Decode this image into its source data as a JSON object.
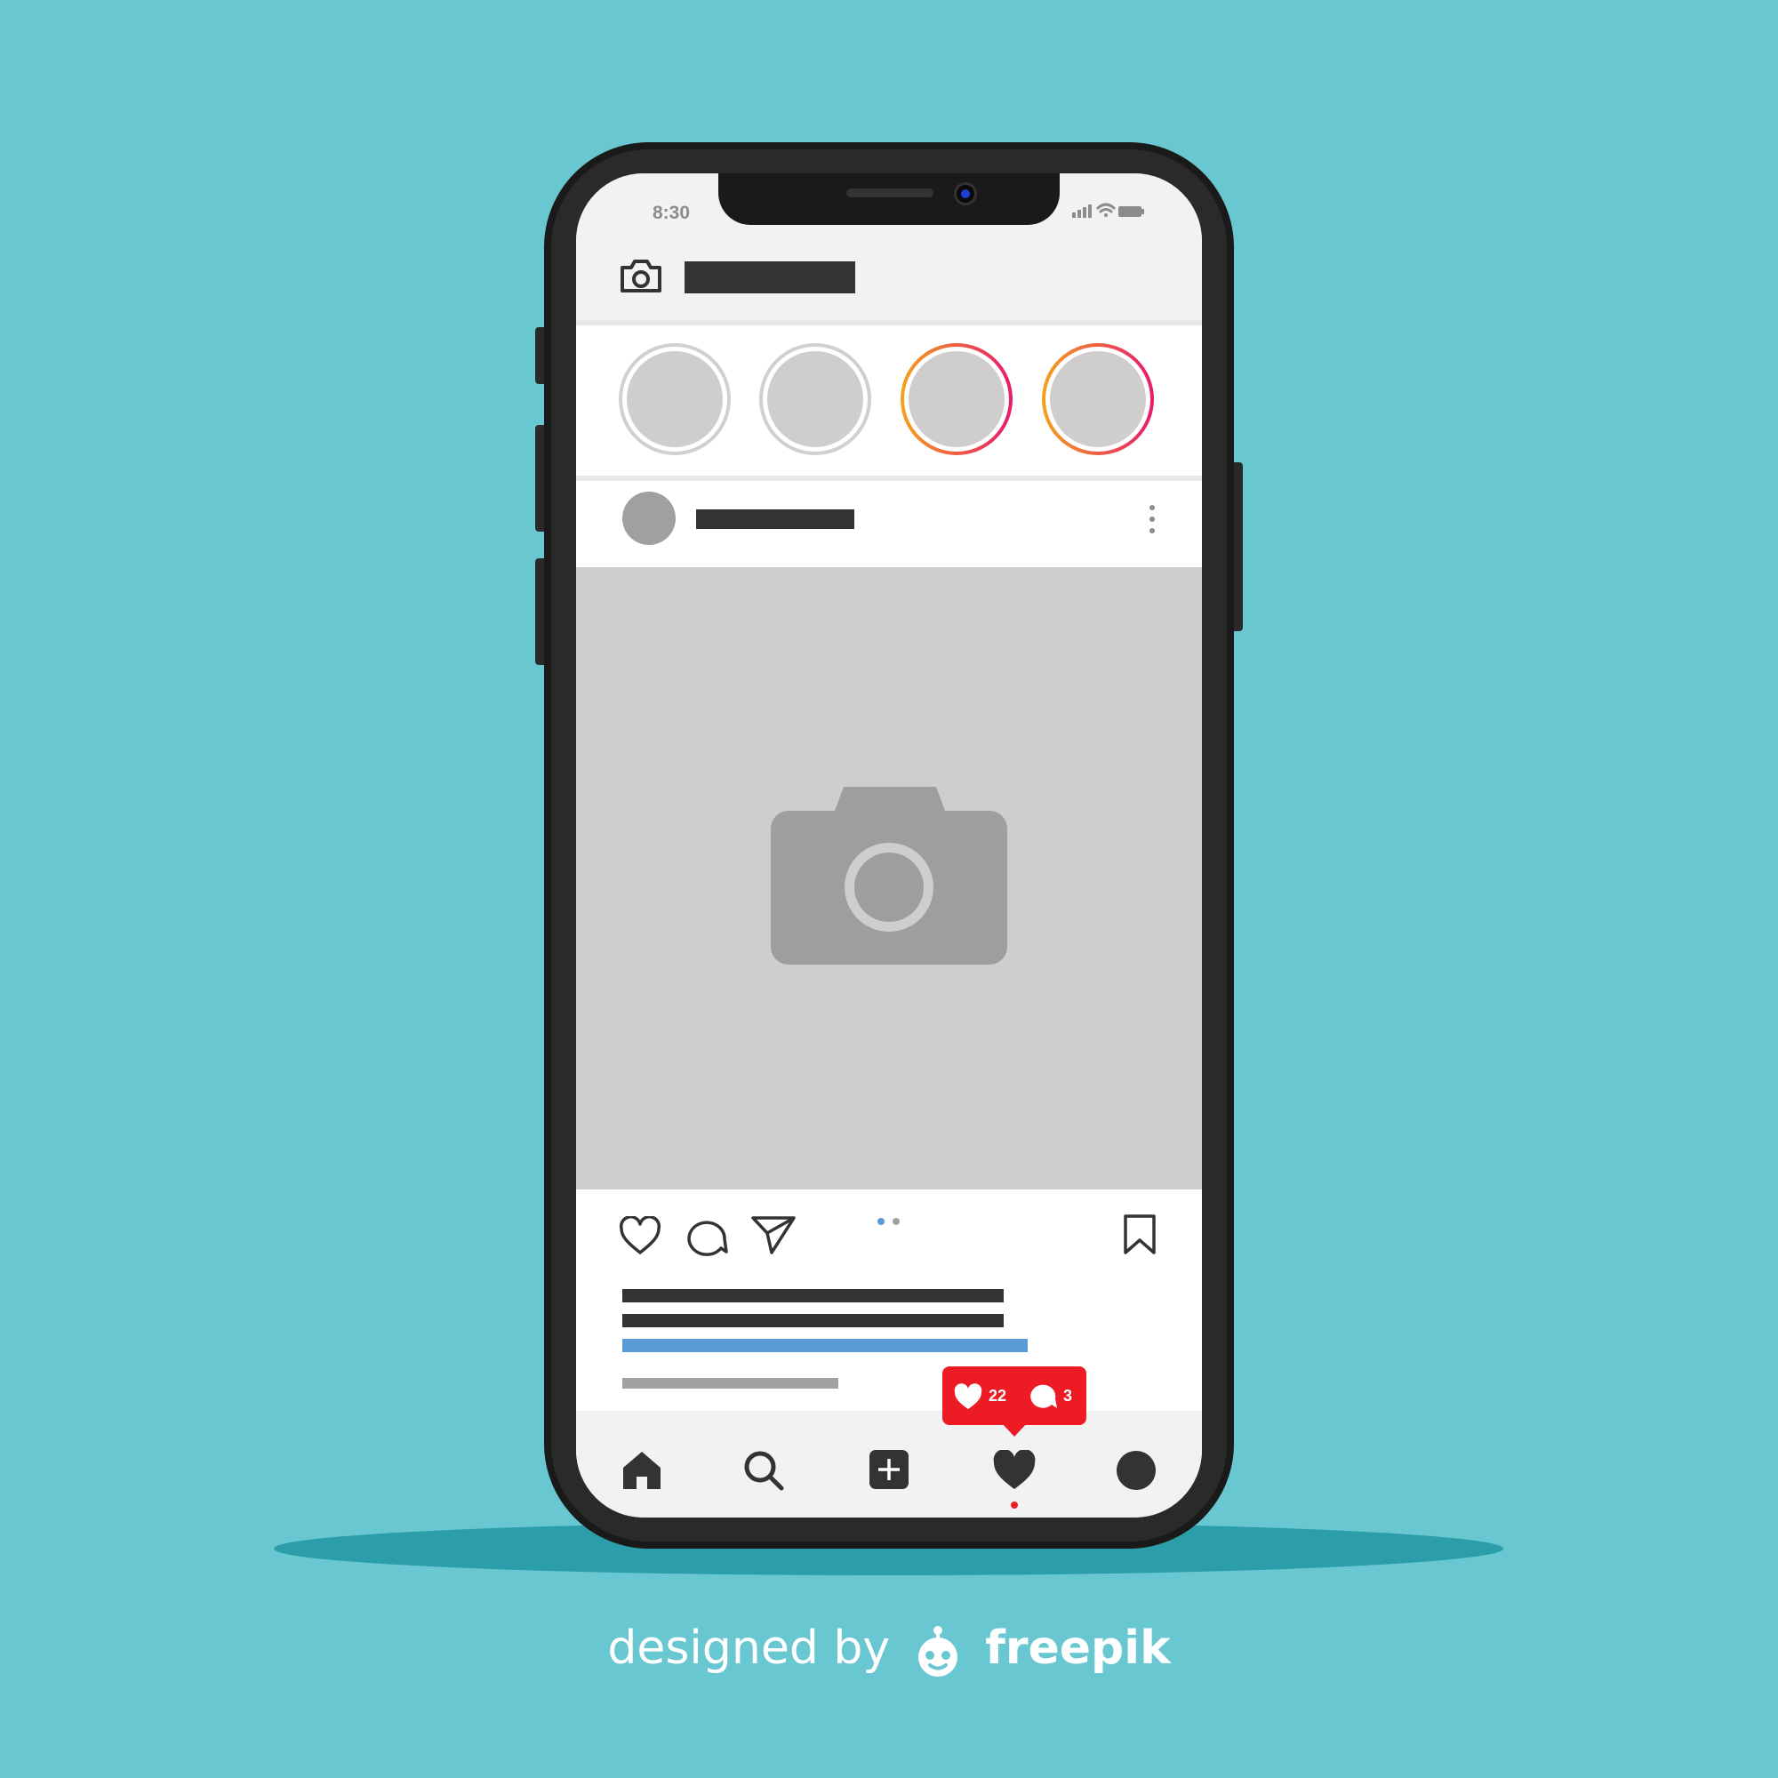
{
  "colors": {
    "background": "#69c7d1",
    "shadow": "#2b9eaa",
    "phone_frame": "#1a1a1a",
    "screen_bar": "#f2f2f2",
    "placeholder_dark": "#333333",
    "placeholder_gray": "#a0a0a0",
    "photo_bg": "#cfcdce",
    "photo_camera": "#9e9e9e",
    "link_blue": "#5b9bd5",
    "notification_red": "#ed1c24",
    "story_seen_ring": "#d0d0d0",
    "story_new_ring_start": "#f4a21d",
    "story_new_ring_end": "#e8196f"
  },
  "status_bar": {
    "time": "8:30",
    "icons": [
      "signal-icon",
      "wifi-icon",
      "battery-icon"
    ]
  },
  "header": {
    "icon": "camera-icon"
  },
  "stories": [
    {
      "state": "seen"
    },
    {
      "state": "seen"
    },
    {
      "state": "new"
    },
    {
      "state": "new"
    }
  ],
  "post": {
    "menu_icon": "more-vertical-icon",
    "image_icon": "camera-icon",
    "carousel": {
      "pages": 2,
      "current": 1
    },
    "actions": [
      "heart-icon",
      "comment-icon",
      "send-icon"
    ],
    "save_icon": "bookmark-icon"
  },
  "notification": {
    "likes": "22",
    "comments": "3"
  },
  "tab_bar": {
    "items": [
      "home-icon",
      "search-icon",
      "add-icon",
      "heart-icon",
      "profile-icon"
    ],
    "active_index": 3
  },
  "credit": {
    "prefix": "designed by",
    "brand": "freepik"
  }
}
